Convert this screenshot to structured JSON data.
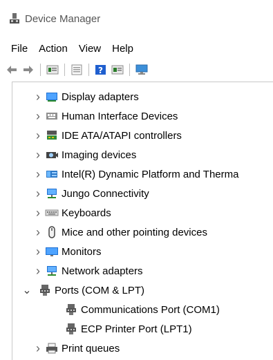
{
  "window": {
    "title": "Device Manager"
  },
  "menu": [
    "File",
    "Action",
    "View",
    "Help"
  ],
  "toolbar": {
    "buttons": [
      "back-arrow-icon",
      "forward-arrow-icon",
      "properties-icon",
      "update-icon",
      "help-icon",
      "view-icon",
      "monitor-scan-icon"
    ]
  },
  "tree": {
    "items": [
      {
        "label": "Display adapters",
        "expanded": false,
        "icon": "display-adapter-icon"
      },
      {
        "label": "Human Interface Devices",
        "expanded": false,
        "icon": "hid-icon"
      },
      {
        "label": "IDE ATA/ATAPI controllers",
        "expanded": false,
        "icon": "ide-controller-icon"
      },
      {
        "label": "Imaging devices",
        "expanded": false,
        "icon": "camera-icon"
      },
      {
        "label": "Intel(R) Dynamic Platform and Therma",
        "expanded": false,
        "icon": "intel-platform-icon"
      },
      {
        "label": "Jungo Connectivity",
        "expanded": false,
        "icon": "network-icon"
      },
      {
        "label": "Keyboards",
        "expanded": false,
        "icon": "keyboard-icon"
      },
      {
        "label": "Mice and other pointing devices",
        "expanded": false,
        "icon": "mouse-icon"
      },
      {
        "label": "Monitors",
        "expanded": false,
        "icon": "monitor-icon"
      },
      {
        "label": "Network adapters",
        "expanded": false,
        "icon": "network-adapter-icon"
      },
      {
        "label": "Ports (COM & LPT)",
        "expanded": true,
        "icon": "port-icon",
        "children": [
          {
            "label": "Communications Port (COM1)",
            "icon": "port-icon"
          },
          {
            "label": "ECP Printer Port (LPT1)",
            "icon": "port-icon"
          }
        ]
      },
      {
        "label": "Print queues",
        "expanded": false,
        "icon": "printer-icon"
      }
    ]
  }
}
